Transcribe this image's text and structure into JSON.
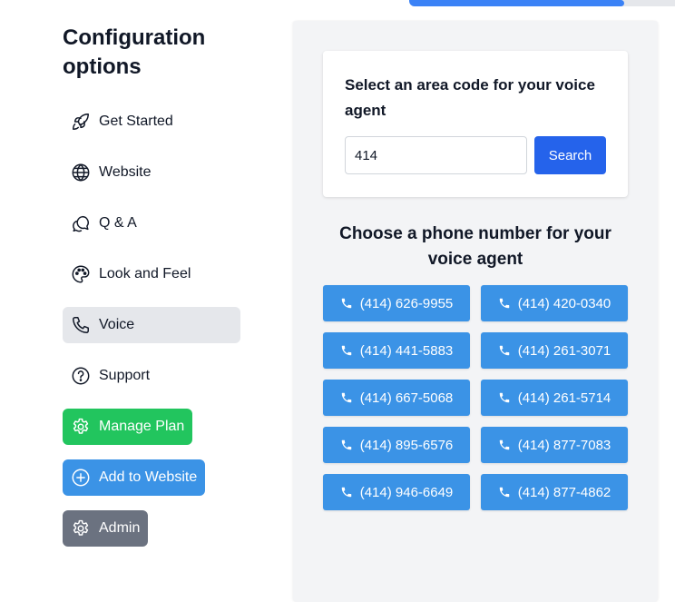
{
  "progress": {
    "fraction": 0.81
  },
  "sidebar": {
    "title": "Configuration options",
    "items": [
      {
        "label": "Get Started",
        "icon": "rocket-icon"
      },
      {
        "label": "Website",
        "icon": "globe-icon"
      },
      {
        "label": "Q & A",
        "icon": "chat-bubbles-icon"
      },
      {
        "label": "Look and Feel",
        "icon": "palette-icon"
      },
      {
        "label": "Voice",
        "icon": "phone-icon",
        "active": true
      },
      {
        "label": "Support",
        "icon": "question-circle-icon"
      },
      {
        "label": "Manage Plan",
        "icon": "gear-icon",
        "color": "#22c55e"
      },
      {
        "label": "Add to Website",
        "icon": "plus-circle-icon",
        "color": "#3b93e6"
      },
      {
        "label": "Admin",
        "icon": "gear-icon",
        "color": "#6b7280"
      }
    ]
  },
  "area_code": {
    "heading": "Select an area code for your voice agent",
    "input_value": "414",
    "search_label": "Search"
  },
  "phone_numbers": {
    "heading": "Choose a phone number for your voice agent",
    "numbers": [
      "(414) 626-9955",
      "(414) 420-0340",
      "(414) 441-5883",
      "(414) 261-3071",
      "(414) 667-5068",
      "(414) 261-5714",
      "(414) 895-6576",
      "(414) 877-7083",
      "(414) 946-6649",
      "(414) 877-4862"
    ]
  },
  "colors": {
    "accent": "#2563eb",
    "number_button": "#3b93e6",
    "manage_plan": "#22c55e",
    "admin": "#6b7280"
  }
}
